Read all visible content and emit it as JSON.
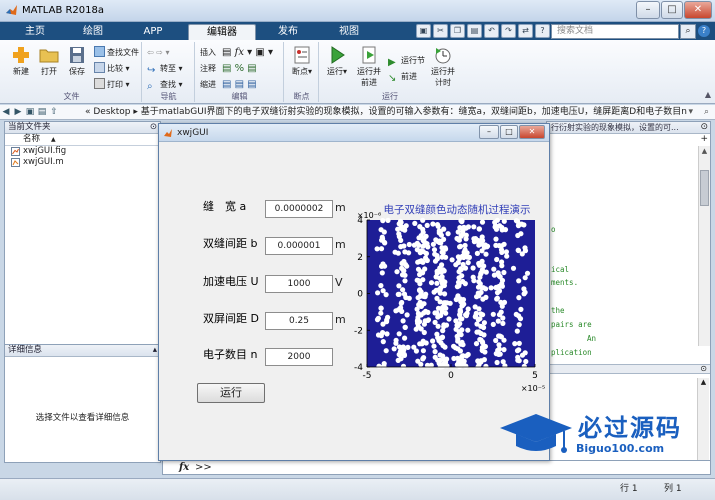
{
  "window": {
    "title": "MATLAB R2018a",
    "min_label": "–",
    "max_label": "□",
    "close_label": "✕"
  },
  "tabs": [
    "主页",
    "绘图",
    "APP",
    "编辑器",
    "发布",
    "视图"
  ],
  "active_tab": "编辑器",
  "search": {
    "placeholder": "搜索文档"
  },
  "toolstrip": {
    "file_group": {
      "label": "文件",
      "new": "新建",
      "open": "打开",
      "save": "保存",
      "find_files": "查找文件",
      "compare": "比较",
      "print": "打印"
    },
    "nav_group": {
      "label": "导航",
      "goto": "转至",
      "find": "查找"
    },
    "edit_group": {
      "label": "编辑",
      "insert": "插入",
      "comment": "注释",
      "indent": "缩进"
    },
    "breakpoint_group": {
      "label": "断点",
      "breakpoints": "断点"
    },
    "run_group": {
      "label": "运行",
      "run": "运行",
      "run_advance_1": "运行并",
      "run_advance_2": "前进",
      "run_section": "运行节",
      "advance": "前进",
      "run_time_1": "运行并",
      "run_time_2": "计时"
    }
  },
  "path": "« Desktop ▸ 基于matlabGUI界面下的电子双缝衍射实验的现象模拟，设置的可输入参数有：缝宽a，双缝间距b，加速电压U，缝屏距离D和电子数目n",
  "left_panel": {
    "title": "当前文件夹",
    "column": "名称",
    "sort_arrow": "▲",
    "files": [
      {
        "name": "xwjGUI.fig",
        "icon": "figure-file-icon"
      },
      {
        "name": "xwjGUI.m",
        "icon": "mfile-icon"
      }
    ],
    "detail_title": "详细信息",
    "detail_msg": "选择文件以查看详细信息"
  },
  "editor": {
    "tab_title": "行衍射实验的现象模拟，设置的可...",
    "code_lines": [
      "o",
      "ical",
      "ments.",
      "the",
      "pairs are",
      "An",
      "plication"
    ]
  },
  "command": {
    "fx": "fx",
    "prompt": ">>"
  },
  "status": {
    "row_label": "行 1",
    "col_label": "列 1"
  },
  "figure_window": {
    "title": "xwjGUI",
    "fields": [
      {
        "label": "缝　宽 a",
        "value": "0.0000002",
        "unit": "m"
      },
      {
        "label": "双缝间距 b",
        "value": "0.000001",
        "unit": "m"
      },
      {
        "label": "加速电压 U",
        "value": "1000",
        "unit": "V"
      },
      {
        "label": "双屏间距 D",
        "value": "0.25",
        "unit": "m"
      },
      {
        "label": "电子数目 n",
        "value": "2000",
        "unit": ""
      }
    ],
    "run_label": "运行"
  },
  "chart_data": {
    "type": "scatter",
    "title": "电子双缝颜色动态随机过程演示",
    "x_exponent": "×10⁻⁵",
    "y_exponent": "×10⁻⁶",
    "xlim": [
      -5,
      5
    ],
    "ylim": [
      -4,
      4
    ],
    "xticks": [
      -5,
      0,
      5
    ],
    "yticks": [
      -4,
      -2,
      0,
      2,
      4
    ],
    "background_color": "#1e1e96",
    "point_color": "#ffffff",
    "fringe_centers": [
      -4.1,
      -2.9,
      -1.75,
      -0.6,
      0.6,
      1.75,
      2.9,
      4.1
    ],
    "fringe_weights": [
      0.35,
      0.6,
      0.8,
      1.0,
      1.0,
      0.8,
      0.6,
      0.35
    ]
  },
  "watermark": {
    "text": "必过源码",
    "url": "Biguo100.com"
  }
}
